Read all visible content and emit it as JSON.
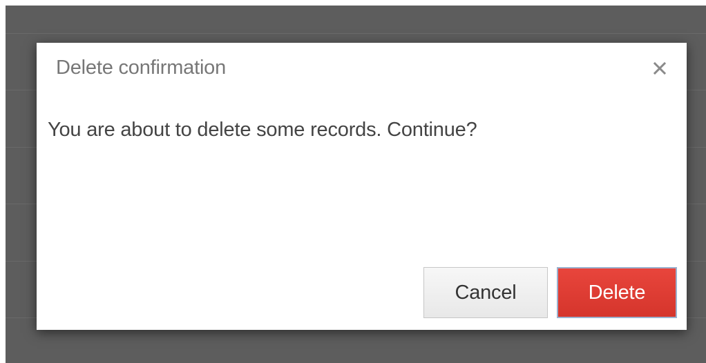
{
  "dialog": {
    "title": "Delete confirmation",
    "close_icon": "close-icon",
    "message": "You are about to delete some records. Continue?",
    "buttons": {
      "cancel_label": "Cancel",
      "delete_label": "Delete"
    }
  },
  "colors": {
    "overlay": "#5d5d5d",
    "dialog_background": "#ffffff",
    "title_text": "#777777",
    "message_text": "#444444",
    "delete_button": "#de3e35",
    "cancel_button": "#efefef"
  }
}
